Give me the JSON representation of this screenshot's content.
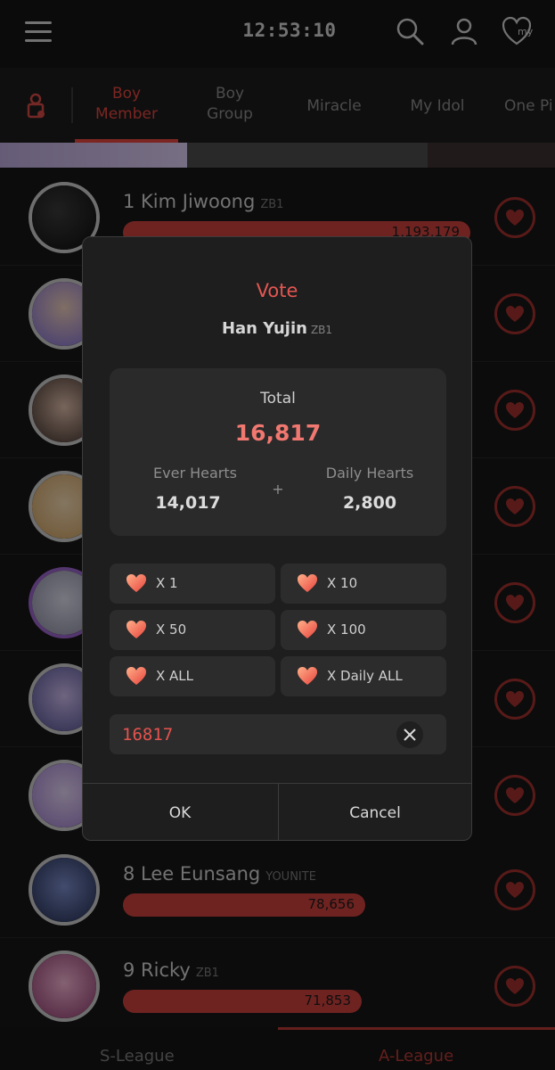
{
  "topbar": {
    "time": "12:53:10",
    "my_label": "my"
  },
  "tabs": [
    {
      "label": "Boy\nMember",
      "line1": "Boy",
      "line2": "Member",
      "active": true
    },
    {
      "line1": "Boy",
      "line2": "Group",
      "active": false
    },
    {
      "line1": "Miracle",
      "line2": "",
      "active": false
    },
    {
      "line1": "My Idol",
      "line2": "",
      "active": false
    },
    {
      "line1": "One Pi",
      "line2": "",
      "active": false
    }
  ],
  "rankings": [
    {
      "text": "1 Kim Jiwoong",
      "group": "ZB1",
      "votes": "1,193,179",
      "bar_fraction": 1.0
    },
    {
      "text": "",
      "group": "",
      "votes": "",
      "bar_fraction": 0
    },
    {
      "text": "",
      "group": "",
      "votes": "",
      "bar_fraction": 0
    },
    {
      "text": "",
      "group": "",
      "votes": "",
      "bar_fraction": 0
    },
    {
      "text": "",
      "group": "",
      "votes": "",
      "bar_fraction": 0
    },
    {
      "text": "",
      "group": "",
      "votes": "",
      "bar_fraction": 0
    },
    {
      "text": "",
      "group": "",
      "votes": "",
      "bar_fraction": 0
    },
    {
      "text": "8 Lee Eunsang",
      "group": "YOUNITE",
      "votes": "78,656",
      "bar_fraction": 0.07
    },
    {
      "text": "9 Ricky",
      "group": "ZB1",
      "votes": "71,853",
      "bar_fraction": 0.065
    }
  ],
  "league": {
    "left": "S-League",
    "right": "A-League"
  },
  "vote_dialog": {
    "title": "Vote",
    "idol_name": "Han Yujin",
    "idol_group": "ZB1",
    "total_label": "Total",
    "total_value": "16,817",
    "ever_label": "Ever Hearts",
    "ever_value": "14,017",
    "plus": "+",
    "daily_label": "Daily Hearts",
    "daily_value": "2,800",
    "multipliers": [
      "X 1",
      "X 10",
      "X 50",
      "X 100",
      "X ALL",
      "X Daily ALL"
    ],
    "amount_value": "16817",
    "ok_label": "OK",
    "cancel_label": "Cancel"
  },
  "colors": {
    "accent": "#e0453f",
    "bar": "#c8413c",
    "background": "#141414"
  },
  "icons": {
    "menu": "menu-icon",
    "search": "search-icon",
    "profile": "profile-icon",
    "my_hearts": "heart-my-icon",
    "lock": "lock-icon",
    "vote_heart": "heart-icon",
    "clear": "close-icon"
  }
}
